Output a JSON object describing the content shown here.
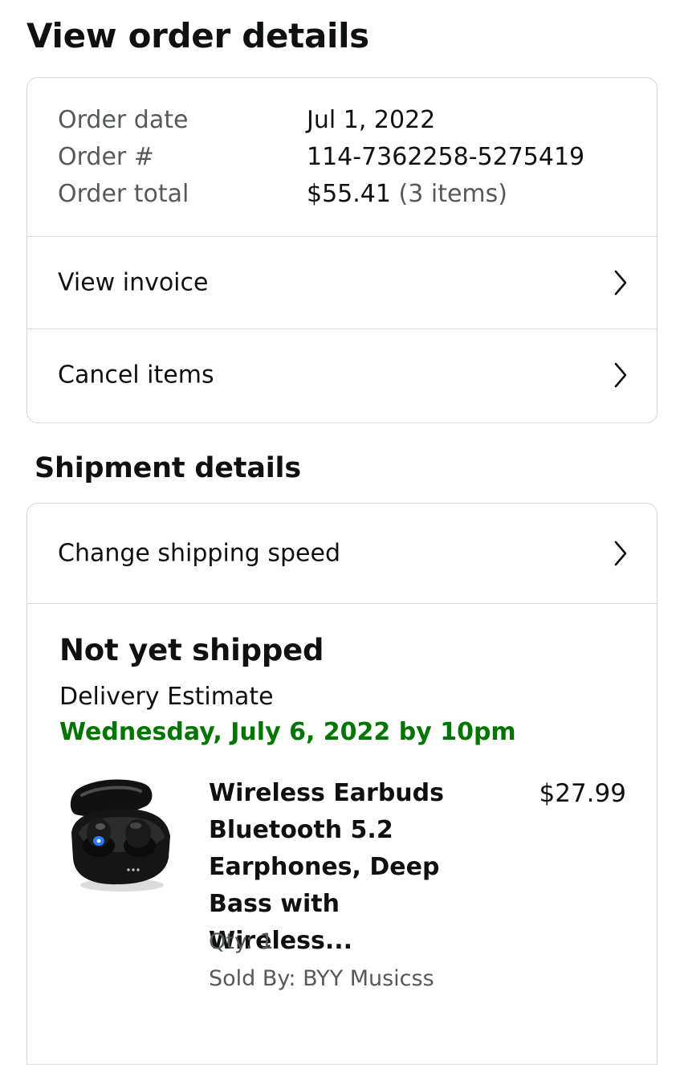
{
  "page": {
    "title": "View order details"
  },
  "order_summary": {
    "date_label": "Order date",
    "date_value": "Jul 1, 2022",
    "number_label": "Order #",
    "number_value": "114-7362258-5275419",
    "total_label": "Order total",
    "total_value": "$55.41",
    "total_items": "(3 items)"
  },
  "order_actions": {
    "view_invoice": "View invoice",
    "cancel_items": "Cancel items"
  },
  "shipment": {
    "section_title": "Shipment details",
    "change_speed": "Change shipping speed",
    "status": "Not yet shipped",
    "delivery_label": "Delivery Estimate",
    "delivery_date": "Wednesday, July 6, 2022 by 10pm",
    "status_color": "#007600",
    "item": {
      "name": "Wireless Earbuds Bluetooth 5.2 Earphones, Deep Bass with Wireless...",
      "price": "$27.99",
      "qty": "Qty: 1",
      "seller": "Sold By: BYY Musicss",
      "image_icon": "earbuds-product-image"
    }
  },
  "colors": {
    "text": "#0f1111",
    "muted": "#565959",
    "border": "#d5d9d9",
    "accent_green": "#007600"
  },
  "icons": {
    "row_chevron": "chevron-right-icon"
  }
}
